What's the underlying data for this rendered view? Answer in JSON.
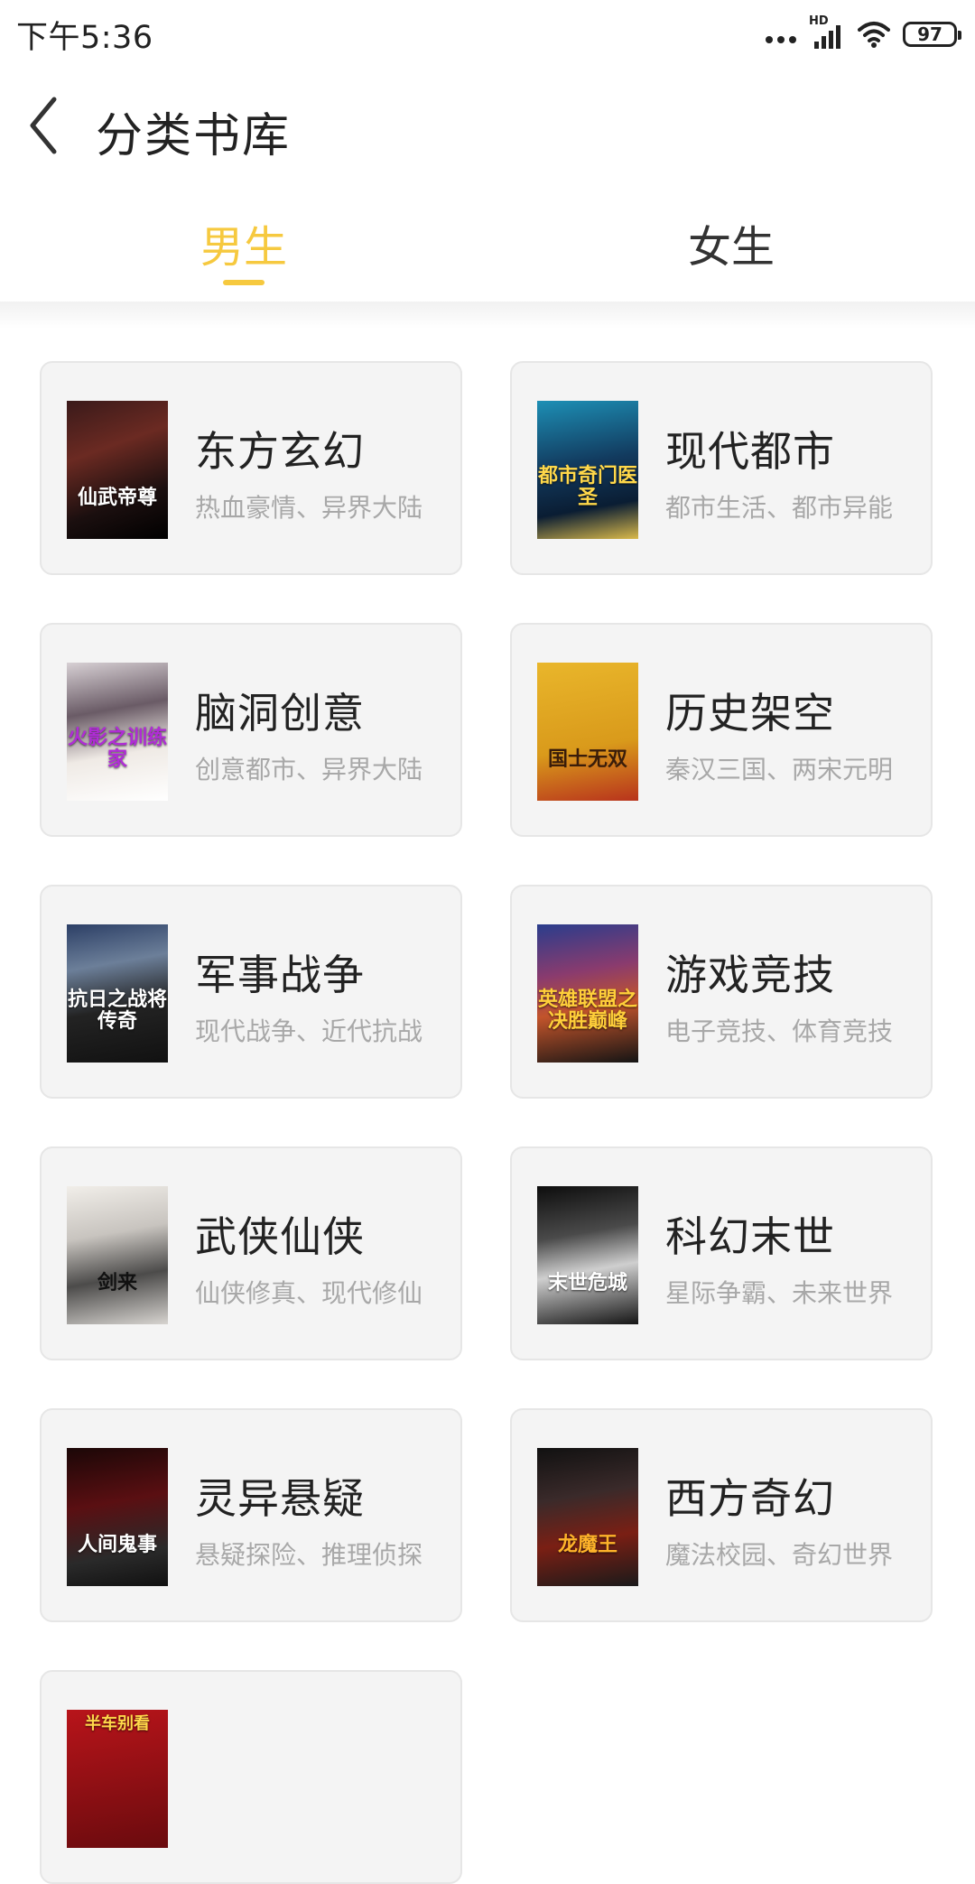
{
  "status_bar": {
    "time": "下午5:36",
    "network_label": "HD",
    "battery": "97"
  },
  "header": {
    "title": "分类书库",
    "back_icon": "chevron-left-icon"
  },
  "tabs": [
    {
      "label": "男生",
      "active": true
    },
    {
      "label": "女生",
      "active": false
    }
  ],
  "accent_color": "#f6c93f",
  "categories": [
    {
      "name": "东方玄幻",
      "desc": "热血豪情、异界大陆",
      "cover_title": "仙武帝尊"
    },
    {
      "name": "现代都市",
      "desc": "都市生活、都市异能",
      "cover_title": "都市奇门医圣"
    },
    {
      "name": "脑洞创意",
      "desc": "创意都市、异界大陆",
      "cover_title": "火影之训练家"
    },
    {
      "name": "历史架空",
      "desc": "秦汉三国、两宋元明",
      "cover_title": "国士无双"
    },
    {
      "name": "军事战争",
      "desc": "现代战争、近代抗战",
      "cover_title": "抗日之战将传奇"
    },
    {
      "name": "游戏竞技",
      "desc": "电子竞技、体育竞技",
      "cover_title": "英雄联盟之决胜巅峰"
    },
    {
      "name": "武侠仙侠",
      "desc": "仙侠修真、现代修仙",
      "cover_title": "剑来"
    },
    {
      "name": "科幻末世",
      "desc": "星际争霸、未来世界",
      "cover_title": "末世危城"
    },
    {
      "name": "灵异悬疑",
      "desc": "悬疑探险、推理侦探",
      "cover_title": "人间鬼事"
    },
    {
      "name": "西方奇幻",
      "desc": "魔法校园、奇幻世界",
      "cover_title": "龙魔王"
    },
    {
      "name": "",
      "desc": "",
      "cover_title": "半车别看"
    }
  ]
}
